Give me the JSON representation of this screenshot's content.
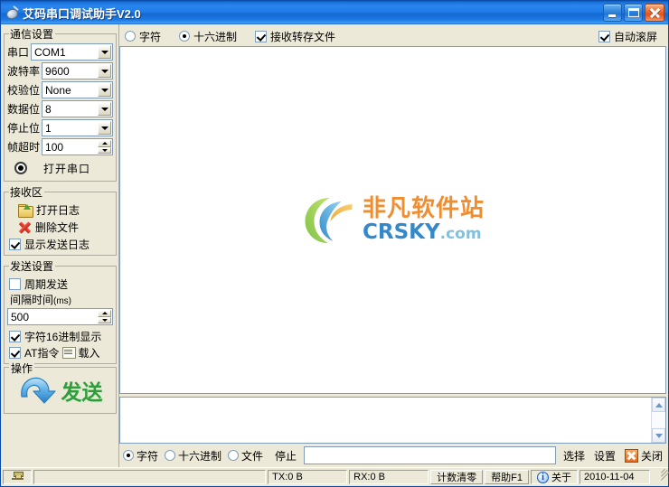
{
  "window": {
    "title": "艾码串口调试助手V2.0",
    "icon": "serial-port-icon",
    "minimize_label": "最小化",
    "maximize_label": "最大化",
    "close_label": "关闭"
  },
  "sidebar": {
    "comm_settings": {
      "legend": "通信设置",
      "fields": [
        {
          "label": "串口",
          "value": "COM1",
          "type": "combo"
        },
        {
          "label": "波特率",
          "value": "9600",
          "type": "combo"
        },
        {
          "label": "校验位",
          "value": "None",
          "type": "combo"
        },
        {
          "label": "数据位",
          "value": "8",
          "type": "combo"
        },
        {
          "label": "停止位",
          "value": "1",
          "type": "combo"
        },
        {
          "label": "帧超时",
          "value": "100",
          "type": "spin"
        }
      ],
      "open_port_label": "打开串口",
      "open_port_state": "closed"
    },
    "receive_zone": {
      "legend": "接收区",
      "open_log_label": "打开日志",
      "delete_file_label": "删除文件",
      "show_send_log_label": "显示发送日志",
      "show_send_log_checked": true
    },
    "send_settings": {
      "legend": "发送设置",
      "cyclic_send_label": "周期发送",
      "cyclic_send_checked": false,
      "interval_label": "间隔时间",
      "interval_unit": "(ms)",
      "interval_value": "500",
      "hex_display_label": "字符16进制显示",
      "hex_display_checked": true,
      "at_command_label": "AT指令",
      "at_command_checked": true,
      "load_label": "载入"
    },
    "operations": {
      "legend": "操作",
      "send_label": "发送"
    }
  },
  "top_toolbar": {
    "char_label": "字符",
    "char_selected": false,
    "hex_label": "十六进制",
    "hex_selected": true,
    "save_to_file_label": "接收转存文件",
    "save_to_file_checked": true,
    "auto_scroll_label": "自动滚屏",
    "auto_scroll_checked": true
  },
  "receive_area": {
    "content": "",
    "watermark": {
      "cn": "非凡软件站",
      "en": "CRSKY",
      "tld": ".com"
    }
  },
  "send_area": {
    "content": ""
  },
  "bottom_toolbar": {
    "char_label": "字符",
    "char_selected": true,
    "hex_label": "十六进制",
    "hex_selected": false,
    "file_label": "文件",
    "file_selected": false,
    "stop_label": "停止",
    "file_path_value": "",
    "select_label": "选择",
    "settings_label": "设置",
    "close_label": "关闭"
  },
  "statusbar": {
    "pin_icon": "pin-icon",
    "message": "",
    "tx_label": "TX:0 B",
    "rx_label": "RX:0 B",
    "reset_count_label": "计数清零",
    "help_label": "帮助F1",
    "about_label": "关于",
    "date": "2010-11-04"
  },
  "colors": {
    "title_bar": "#1f7ae6",
    "panel_bg": "#ece9d8",
    "field_border": "#7f9db9",
    "send_text": "#2f9e3a",
    "watermark_orange": "#ef8a2b",
    "watermark_blue": "#2f86c8",
    "close_orange": "#ea6a17"
  }
}
